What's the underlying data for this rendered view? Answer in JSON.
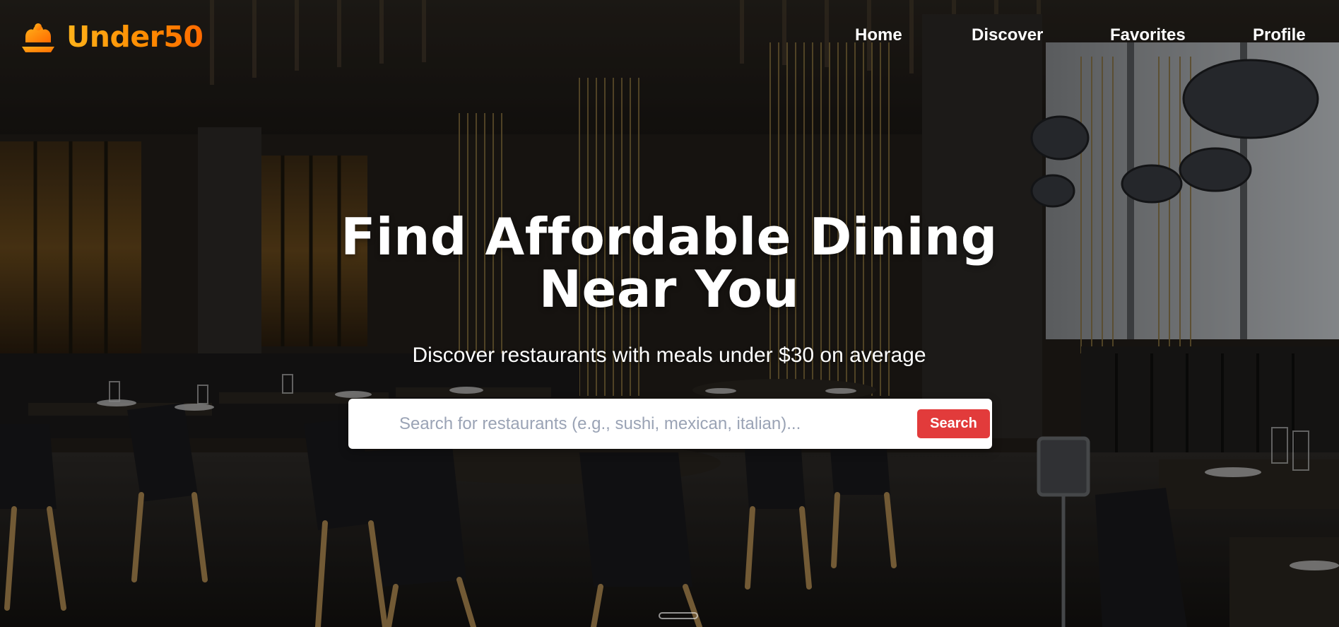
{
  "brand": {
    "name": "Under50",
    "icon": "chef-hat-icon",
    "color_start": "#ffb21a",
    "color_end": "#ff6a00"
  },
  "nav": {
    "items": [
      {
        "label": "Home"
      },
      {
        "label": "Discover"
      },
      {
        "label": "Favorites"
      },
      {
        "label": "Profile"
      }
    ]
  },
  "hero": {
    "title": "Find Affordable Dining Near You",
    "subtitle": "Discover restaurants with meals under $30 on average",
    "search": {
      "placeholder": "Search for restaurants (e.g., sushi, mexican, italian)...",
      "value": "",
      "button_label": "Search",
      "button_color": "#e23b3b"
    }
  }
}
